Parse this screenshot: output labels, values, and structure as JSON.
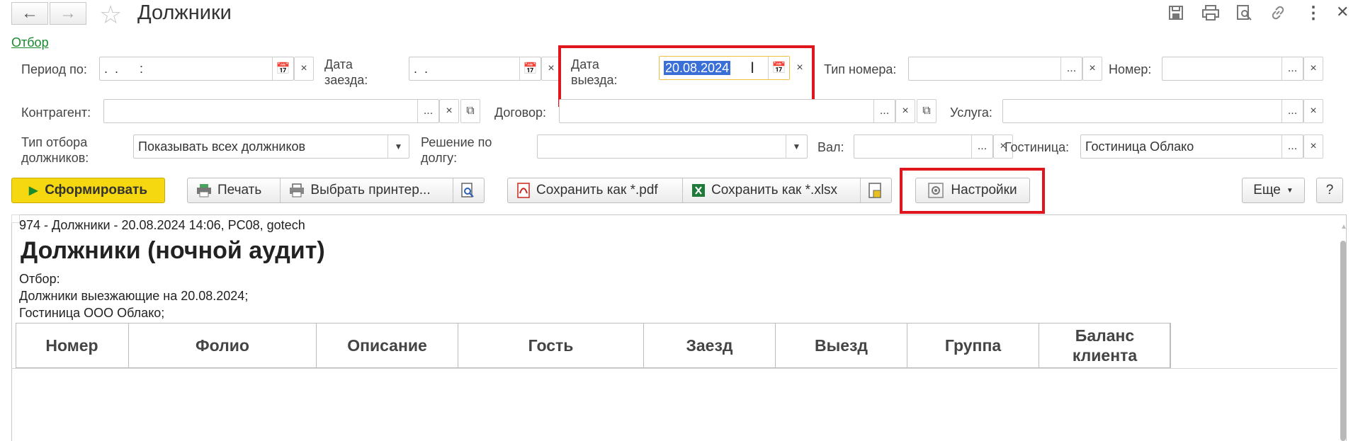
{
  "window": {
    "title": "Должники"
  },
  "filter_link": "Отбор",
  "fields": {
    "period": {
      "label": "Период по:",
      "value": ".  .      :"
    },
    "arrival": {
      "label_line1": "Дата",
      "label_line2": "заезда:",
      "value": ".  ."
    },
    "departure": {
      "label_line1": "Дата",
      "label_line2": "выезда:",
      "value": "20.08.2024"
    },
    "room_type": {
      "label": "Тип номера:",
      "value": ""
    },
    "room": {
      "label": "Номер:",
      "value": ""
    },
    "counterparty": {
      "label": "Контрагент:",
      "value": ""
    },
    "contract": {
      "label": "Договор:",
      "value": ""
    },
    "service": {
      "label": "Услуга:",
      "value": ""
    },
    "debtor_filter": {
      "label_line1": "Тип отбора",
      "label_line2": "должников:",
      "value": "Показывать всех должников"
    },
    "debt_decision": {
      "label_line1": "Решение по",
      "label_line2": "долгу:",
      "value": ""
    },
    "currency": {
      "label": "Вал:",
      "value": ""
    },
    "hotel": {
      "label": "Гостиница:",
      "value": "Гостиница Облако"
    }
  },
  "toolbar": {
    "generate": "Сформировать",
    "print": "Печать",
    "choose_printer": "Выбрать принтер...",
    "save_pdf": "Сохранить как *.pdf",
    "save_xlsx": "Сохранить как *.xlsx",
    "settings": "Настройки",
    "more": "Еще",
    "help": "?"
  },
  "report": {
    "header_line": "974 - Должники - 20.08.2024 14:06, PC08, gotech",
    "title": "Должники (ночной аудит)",
    "filter_label": "Отбор:",
    "filter_line1": "Должники выезжающие на 20.08.2024;",
    "filter_line2": "Гостиница ООО Облако;",
    "columns": [
      "Номер",
      "Фолио",
      "Описание",
      "Гость",
      "Заезд",
      "Выезд",
      "Группа",
      "Баланс клиента"
    ]
  },
  "colors": {
    "accent_green": "#1a8a2e",
    "highlight_red": "#e0161e",
    "generate_yellow": "#f5d80f",
    "selection_blue": "#3a6fd8"
  }
}
